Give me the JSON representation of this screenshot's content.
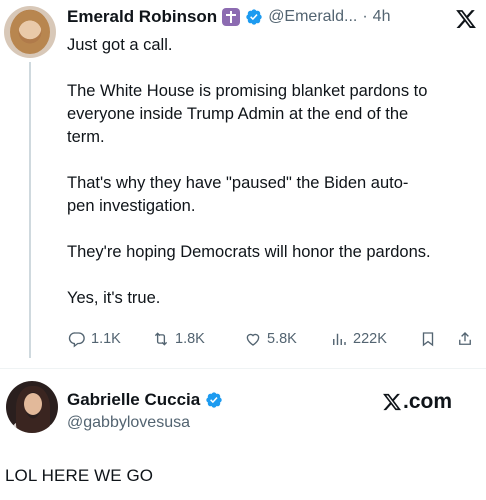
{
  "tweet": {
    "author_name": "Emerald Robinson",
    "author_handle": "@Emerald...",
    "separator": "·",
    "time": "4h",
    "paragraphs": [
      "Just got a call.",
      "The White House is promising blanket pardons to\neveryone inside Trump Admin at the end of the\nterm.",
      "That's why they have \"paused\" the Biden auto-\npen investigation.",
      "They're hoping Democrats will honor the pardons.",
      "Yes, it's true."
    ],
    "stats": {
      "replies": "1.1K",
      "reposts": "1.8K",
      "likes": "5.8K",
      "views": "222K"
    },
    "icons": [
      "cross-badge-icon",
      "verified-badge-icon",
      "x-logo-icon",
      "reply-icon",
      "repost-icon",
      "like-icon",
      "views-icon",
      "bookmark-icon",
      "share-icon"
    ]
  },
  "profile_card": {
    "name": "Gabrielle Cuccia",
    "handle": "@gabbylovesusa",
    "brand": ".com"
  },
  "caption": "LOL HERE WE GO",
  "colors": {
    "text": "#0f1419",
    "secondary": "#536471",
    "verified": "#1d9bf0",
    "cross_badge": "#8c6bb1"
  }
}
